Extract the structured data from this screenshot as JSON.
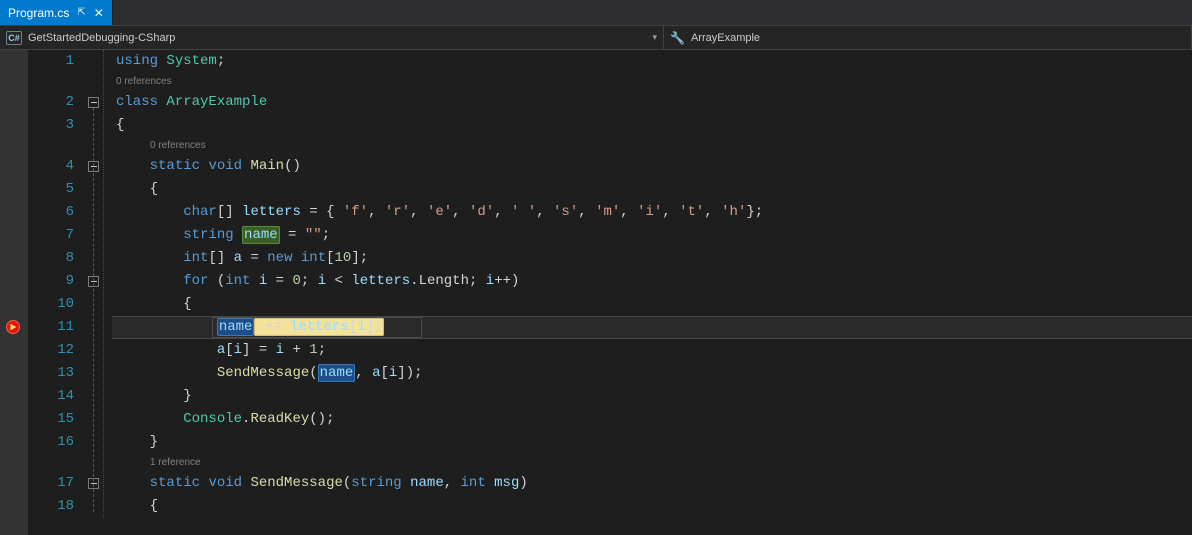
{
  "tab": {
    "title": "Program.cs",
    "pin_icon": "⇱",
    "close_icon": "✕"
  },
  "nav": {
    "left_icon": "C#",
    "left_text": "GetStartedDebugging-CSharp",
    "right_icon": "🔧",
    "right_text": "ArrayExample",
    "dropdown_glyph": "▾"
  },
  "refs": {
    "zero": "0 references",
    "one": "1 reference"
  },
  "line_numbers": [
    "1",
    "2",
    "3",
    "4",
    "5",
    "6",
    "7",
    "8",
    "9",
    "10",
    "11",
    "12",
    "13",
    "14",
    "15",
    "16",
    "17",
    "18"
  ],
  "breakpoint_line": 11,
  "code": {
    "l1": {
      "using": "using",
      "system": "System",
      "semi": ";"
    },
    "l2": {
      "cls": "class",
      "name": "ArrayExample"
    },
    "l3": {
      "brace": "{"
    },
    "l4": {
      "stat": "static",
      "vd": "void",
      "main": "Main",
      "paren": "()"
    },
    "l5": {
      "brace": "{"
    },
    "l6": {
      "chr": "char",
      "brk": "[] ",
      "var": "letters",
      "eq": " = { ",
      "items": [
        "'f'",
        "'r'",
        "'e'",
        "'d'",
        "' '",
        "'s'",
        "'m'",
        "'i'",
        "'t'",
        "'h'"
      ],
      "close": "};"
    },
    "l7": {
      "str": "string",
      "var": "name",
      "eq": " = ",
      "val": "\"\"",
      "semi": ";"
    },
    "l8": {
      "intkw": "int",
      "brk": "[] ",
      "var": "a",
      "eq": " = ",
      "newkw": "new",
      "sp": " ",
      "int2": "int",
      "size": "[10]",
      "semi": ";"
    },
    "l9": {
      "forkw": "for",
      "open": " (",
      "intkw": "int",
      "i": "i",
      "eq": " = ",
      "zero": "0",
      "semi1": "; ",
      "i2": "i",
      "lt": " < ",
      "letters": "letters",
      "dot": ".",
      "len": "Length",
      "semi2": "; ",
      "i3": "i",
      "inc": "++",
      "close": ")"
    },
    "l10": {
      "brace": "{"
    },
    "l11": {
      "var": "name",
      "op": " += ",
      "letters": "letters",
      "idx_open": "[",
      "i": "i",
      "idx_close": "]",
      "semi": ";"
    },
    "l12": {
      "a": "a",
      "idx_open": "[",
      "i": "i",
      "idx_close": "]",
      "eq": " = ",
      "i2": "i",
      "plus": " + ",
      "one": "1",
      "semi": ";"
    },
    "l13": {
      "fn": "SendMessage",
      "open": "(",
      "name": "name",
      "comma": ", ",
      "a": "a",
      "idx_open": "[",
      "i": "i",
      "idx_close": "]",
      "close": ")",
      "semi": ";"
    },
    "l14": {
      "brace": "}"
    },
    "l15": {
      "console": "Console",
      "dot": ".",
      "rk": "ReadKey",
      "paren": "()",
      "semi": ";"
    },
    "l16": {
      "brace": "}"
    },
    "l17": {
      "stat": "static",
      "vd": "void",
      "fn": "SendMessage",
      "open": "(",
      "strkw": "string",
      "p1": "name",
      "comma": ", ",
      "intkw": "int",
      "p2": "msg",
      "close": ")"
    },
    "l18": {
      "brace": "{"
    }
  }
}
